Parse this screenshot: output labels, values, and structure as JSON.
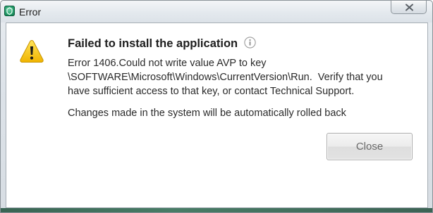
{
  "window": {
    "title": "Error",
    "title_icon": "app-shield-icon",
    "close_icon": "close-icon"
  },
  "dialog": {
    "heading": "Failed to install the application",
    "info_icon": "info-icon",
    "warning_icon": "warning-triangle-icon",
    "message": "Error 1406.Could not write value AVP to key\n\\SOFTWARE\\Microsoft\\Windows\\CurrentVersion\\Run.  Verify that you\nhave sufficient access to that key, or contact Technical Support.",
    "rollback_note": "Changes made in the system will be automatically rolled back",
    "close_button_label": "Close"
  },
  "colors": {
    "warning_yellow": "#f2c400",
    "button_text": "#6a6a6a",
    "heading_text": "#1e1e1e"
  }
}
